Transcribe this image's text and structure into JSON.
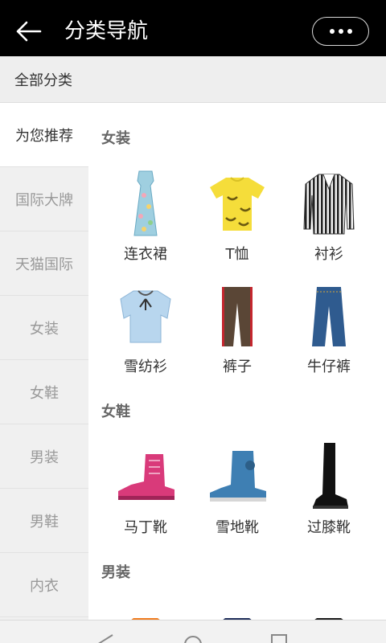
{
  "header": {
    "title": "分类导航",
    "back_icon": "arrow-left-icon",
    "more_icon": "more-dots-icon"
  },
  "all_categories": {
    "label": "全部分类"
  },
  "sidebar": {
    "items": [
      {
        "label": "为您推荐",
        "active": true
      },
      {
        "label": "国际大牌",
        "active": false
      },
      {
        "label": "天猫国际",
        "active": false
      },
      {
        "label": "女装",
        "active": false
      },
      {
        "label": "女鞋",
        "active": false
      },
      {
        "label": "男装",
        "active": false
      },
      {
        "label": "男鞋",
        "active": false
      },
      {
        "label": "内衣",
        "active": false
      }
    ]
  },
  "sections": [
    {
      "title": "女装",
      "items": [
        {
          "label": "连衣裙",
          "icon": "dress-icon"
        },
        {
          "label": "T恤",
          "icon": "tshirt-icon"
        },
        {
          "label": "衬衫",
          "icon": "striped-shirt-icon"
        },
        {
          "label": "雪纺衫",
          "icon": "chiffon-blouse-icon"
        },
        {
          "label": "裤子",
          "icon": "pants-icon"
        },
        {
          "label": "牛仔裤",
          "icon": "jeans-icon"
        }
      ]
    },
    {
      "title": "女鞋",
      "items": [
        {
          "label": "马丁靴",
          "icon": "martin-boot-icon"
        },
        {
          "label": "雪地靴",
          "icon": "snow-boot-icon"
        },
        {
          "label": "过膝靴",
          "icon": "knee-boot-icon"
        }
      ]
    },
    {
      "title": "男装",
      "items": [
        {
          "label": "",
          "icon": "orange-jacket-icon"
        },
        {
          "label": "",
          "icon": "navy-jacket-icon"
        },
        {
          "label": "",
          "icon": "black-jacket-icon"
        }
      ]
    }
  ],
  "navbar": {
    "back_icon": "nav-back-icon",
    "home_icon": "nav-home-icon",
    "recents_icon": "nav-recents-icon"
  },
  "colors": {
    "titlebar_bg": "#000000",
    "sidebar_bg": "#f0f0f0",
    "active_text": "#333333",
    "inactive_text": "#999999"
  }
}
